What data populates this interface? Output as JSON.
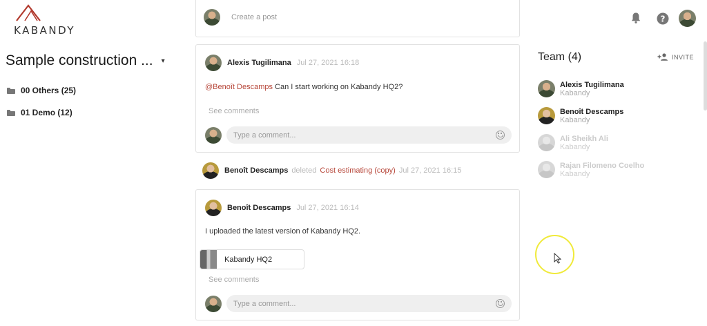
{
  "brand": {
    "logo_text": "KABANDY"
  },
  "header": {
    "bell_icon": "bell-icon",
    "help_icon": "help-icon"
  },
  "project": {
    "title": "Sample construction ...",
    "caret": "▾"
  },
  "folders": [
    {
      "label": "00 Others (25)"
    },
    {
      "label": "01 Demo (12)"
    }
  ],
  "composer": {
    "placeholder": "Create a post"
  },
  "posts": [
    {
      "author": "Alexis Tugilimana",
      "time": "Jul 27, 2021 16:18",
      "mention": "@Benoît Descamps",
      "text": " Can I start working on Kabandy HQ2?",
      "see_comments": "See comments",
      "comment_placeholder": "Type a comment..."
    },
    {
      "author": "Benoît Descamps",
      "time": "Jul 27, 2021 16:14",
      "text": "I uploaded the latest version of Kabandy HQ2.",
      "attachment": "Kabandy HQ2",
      "see_comments": "See comments",
      "comment_placeholder": "Type a comment..."
    }
  ],
  "activity": {
    "author": "Benoît Descamps",
    "verb": "deleted",
    "item": "Cost estimating (copy)",
    "time": "Jul 27, 2021 16:15"
  },
  "team": {
    "title": "Team (4)",
    "invite_label": "INVITE",
    "members": [
      {
        "name": "Alexis Tugilimana",
        "company": "Kabandy"
      },
      {
        "name": "Benoît Descamps",
        "company": "Kabandy"
      },
      {
        "name": "Ali Sheikh Ali",
        "company": "Kabandy"
      },
      {
        "name": "Rajan Filomeno Coelho",
        "company": "Kabandy"
      }
    ]
  },
  "colors": {
    "accent": "#b7473a",
    "highlight_ring": "#f0ea3a"
  }
}
